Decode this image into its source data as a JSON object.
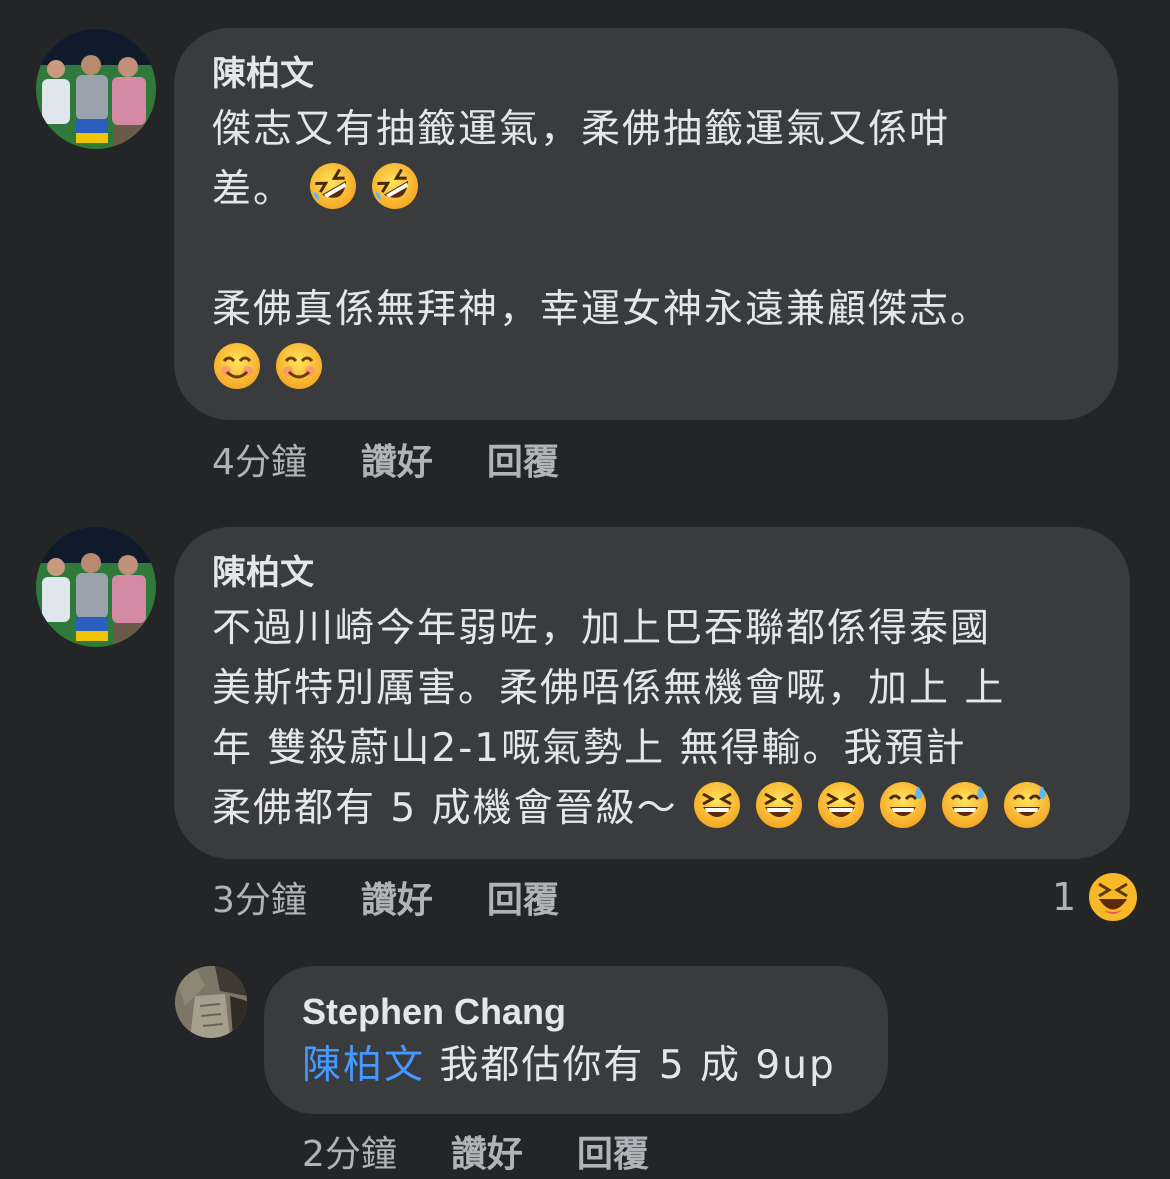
{
  "comments": [
    {
      "author": "陳柏文",
      "line1": "傑志又有抽籤運氣，柔佛抽籤運氣又係咁",
      "line2": "差。",
      "line3": "柔佛真係無拜神，幸運女神永遠兼顧傑志。",
      "time": "4分鐘",
      "like_label": "讚好",
      "reply_label": "回覆"
    },
    {
      "author": "陳柏文",
      "line1": "不過川崎今年弱咗，加上巴吞聯都係得泰國",
      "line2": "美斯特別厲害。柔佛唔係無機會嘅，加上 上",
      "line3": "年 雙殺蔚山2-1嘅氣勢上 無得輸。我預計",
      "line4": "柔佛都有 5 成機會晉級～",
      "time": "3分鐘",
      "like_label": "讚好",
      "reply_label": "回覆",
      "reaction_count": "1"
    }
  ],
  "reply": {
    "author": "Stephen Chang",
    "mention": "陳柏文",
    "text": "我都估你有 5 成 9up",
    "time": "2分鐘",
    "like_label": "讚好",
    "reply_label": "回覆"
  },
  "icons": {
    "rofl": "rolling-on-floor-laughing-emoji",
    "smile": "smiling-face-emoji",
    "laugh": "grinning-squinting-face-emoji",
    "sweat": "grinning-face-with-sweat-emoji",
    "reaction": "haha-reaction-icon"
  },
  "colors": {
    "background": "#242526",
    "bubble": "#3a3b3c",
    "mention": "#4599ff",
    "secondary_text": "#b0b3b8"
  }
}
